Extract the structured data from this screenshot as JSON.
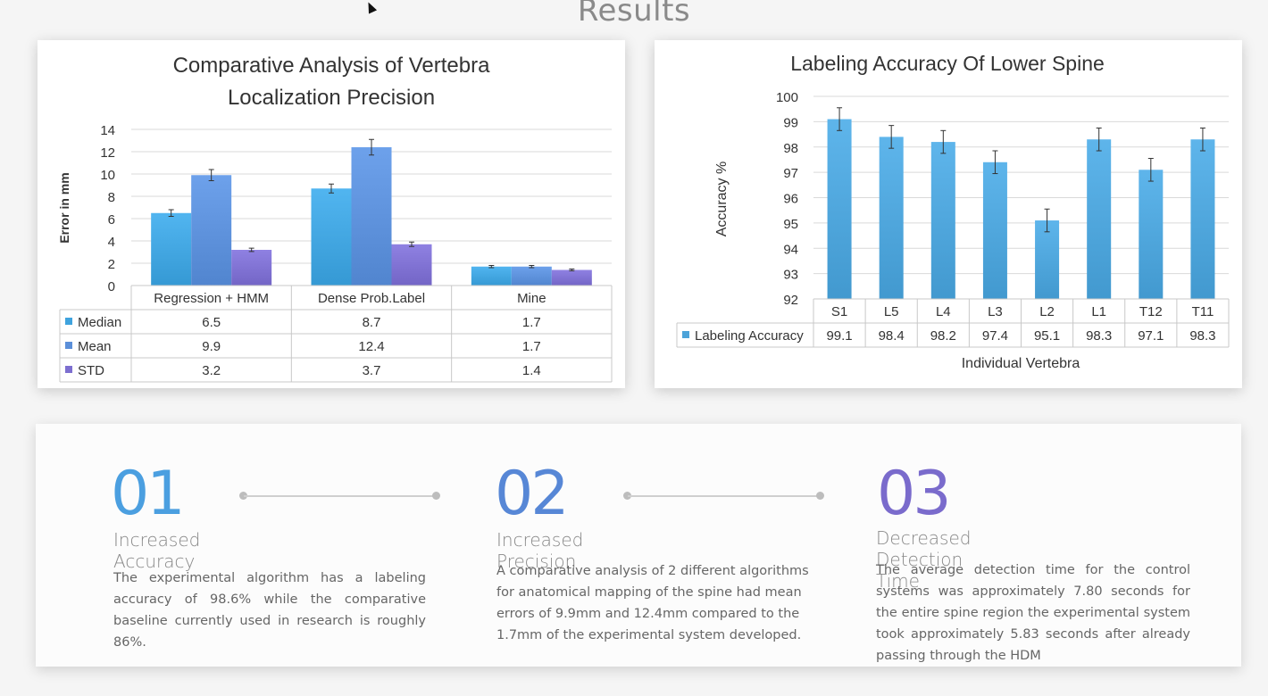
{
  "page": {
    "title": "Results"
  },
  "chart_data": [
    {
      "type": "bar",
      "title_line1": "Comparative Analysis of Vertebra",
      "title_line2": "Localization Precision",
      "ylabel": "Error in mm",
      "ylim": [
        0,
        14
      ],
      "yticks": [
        0,
        2,
        4,
        6,
        8,
        10,
        12,
        14
      ],
      "categories": [
        "Regression + HMM",
        "Dense Prob.Label",
        "Mine"
      ],
      "series": [
        {
          "name": "Median",
          "values": [
            6.5,
            8.7,
            1.7
          ],
          "display": [
            "6.5",
            "8.7",
            "1.7"
          ],
          "error": [
            0.3,
            0.4,
            0.1
          ],
          "color": "#3fa3de"
        },
        {
          "name": "Mean",
          "values": [
            9.9,
            12.4,
            1.7
          ],
          "display": [
            "9.9",
            "12.4",
            "1.7"
          ],
          "error": [
            0.5,
            0.7,
            0.1
          ],
          "color": "#5b8fd9"
        },
        {
          "name": "STD",
          "values": [
            3.2,
            3.7,
            1.4
          ],
          "display": [
            "3.2",
            "3.7",
            "1.4"
          ],
          "error": [
            0.15,
            0.2,
            0.08
          ],
          "color": "#7d6fd0"
        }
      ],
      "grid": true,
      "legend": "data-table"
    },
    {
      "type": "bar",
      "title": "Labeling Accuracy Of Lower Spine",
      "ylabel": "Accuracy %",
      "xlabel": "Individual Vertebra",
      "ylim": [
        92,
        100
      ],
      "yticks": [
        92,
        93,
        94,
        95,
        96,
        97,
        98,
        99,
        100
      ],
      "categories": [
        "S1",
        "L5",
        "L4",
        "L3",
        "L2",
        "L1",
        "T12",
        "T11"
      ],
      "series": [
        {
          "name": "Labeling Accuracy",
          "values": [
            99.1,
            98.4,
            98.2,
            97.4,
            95.1,
            98.3,
            97.1,
            98.3
          ],
          "display": [
            "99.1",
            "98.4",
            "98.2",
            "97.4",
            "95.1",
            "98.3",
            "97.1",
            "98.3"
          ],
          "error": [
            0.45,
            0.45,
            0.45,
            0.45,
            0.45,
            0.45,
            0.45,
            0.45
          ],
          "color": "#4ca3d9"
        }
      ],
      "grid": true,
      "legend": "data-table"
    }
  ],
  "steps": [
    {
      "number": "01",
      "heading": "Increased Accuracy",
      "color": "#4b9fe0",
      "body": "The experimental algorithm has a labeling accuracy of 98.6% while the comparative baseline currently used in research is roughly 86%."
    },
    {
      "number": "02",
      "heading": "Increased Precision",
      "color": "#5787d6",
      "body": "A comparative analysis of 2 different algorithms for anatomical mapping of the spine had mean errors of 9.9mm and 12.4mm compared to the 1.7mm of the experimental system developed."
    },
    {
      "number": "03",
      "heading": "Decreased Detection Time",
      "color": "#7a6bcc",
      "body": "The average detection time for the control systems was approximately 7.80 seconds for the entire spine region the experimental system took approximately 5.83 seconds after already passing through the HDM"
    }
  ]
}
